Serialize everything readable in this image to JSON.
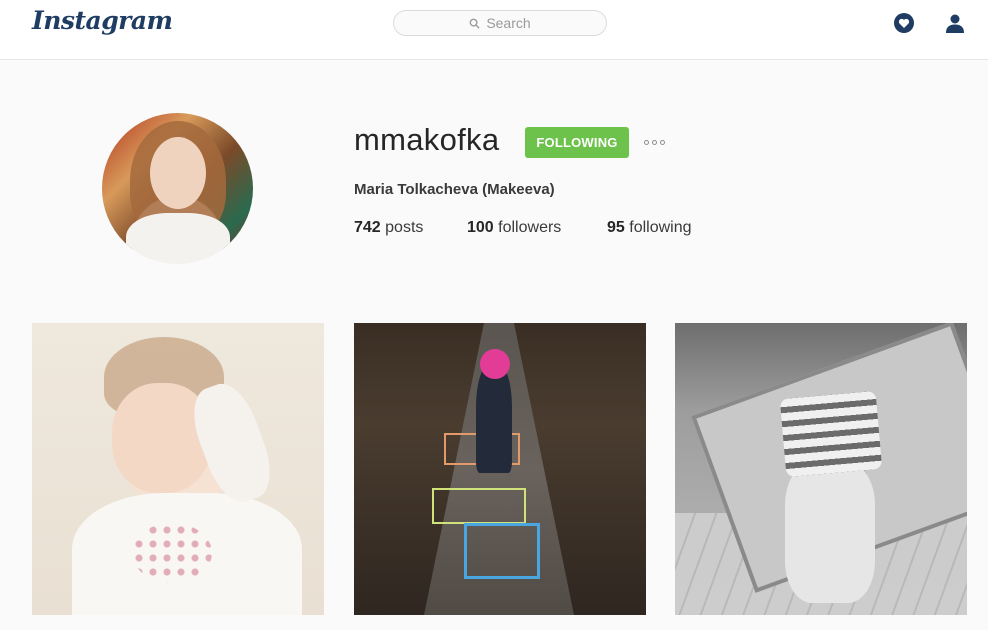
{
  "header": {
    "logo_text": "Instagram",
    "search_placeholder": "Search",
    "icons": [
      "search-icon",
      "activity-heart-icon",
      "profile-person-icon"
    ]
  },
  "profile": {
    "username": "mmakofka",
    "follow_button_label": "FOLLOWING",
    "full_name": "Maria Tolkacheva (Makeeva)",
    "stats": {
      "posts_count": "742",
      "posts_label": "posts",
      "followers_count": "100",
      "followers_label": "followers",
      "following_count": "95",
      "following_label": "following"
    }
  },
  "colors": {
    "brand": "#1f3d63",
    "following_green": "#6cc24a",
    "background": "#fafafa"
  },
  "posts": [
    {
      "subject": "toddler portrait"
    },
    {
      "subject": "child playing hopscotch"
    },
    {
      "subject": "black and white scene on rug"
    }
  ]
}
